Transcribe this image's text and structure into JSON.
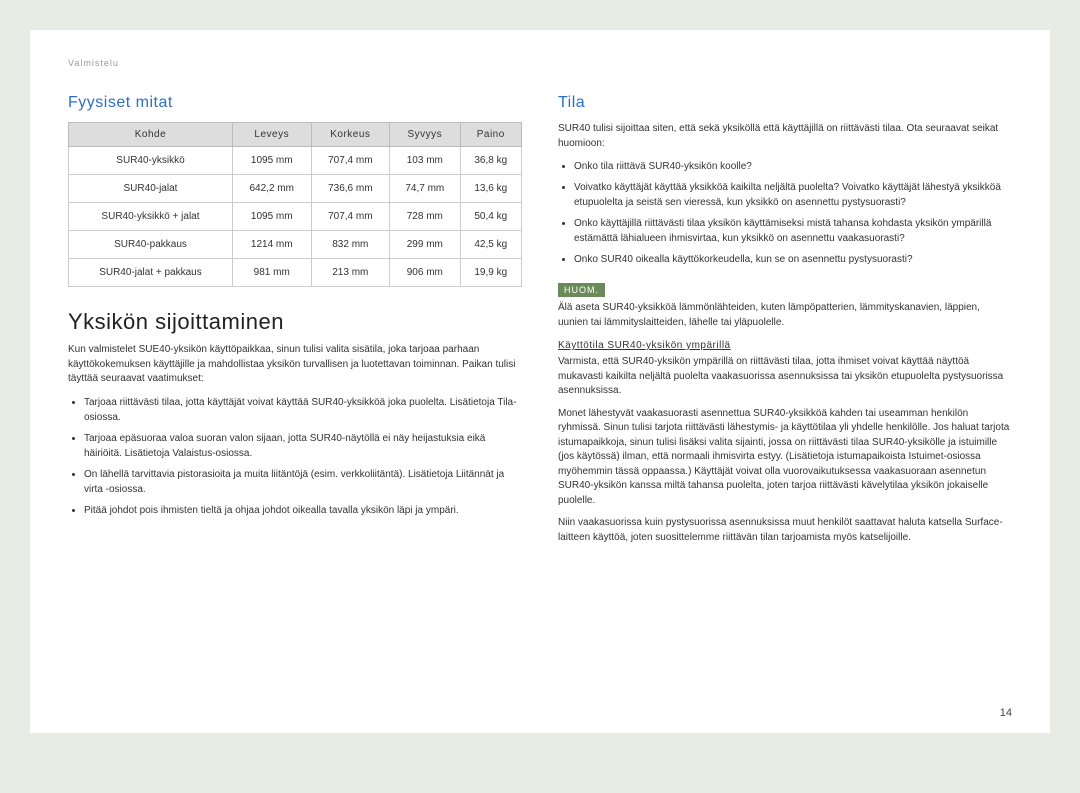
{
  "header": "Valmistelu",
  "left": {
    "h2": "Fyysiset mitat",
    "table": {
      "headers": [
        "Kohde",
        "Leveys",
        "Korkeus",
        "Syvyys",
        "Paino"
      ],
      "rows": [
        [
          "SUR40-yksikkö",
          "1095 mm",
          "707,4 mm",
          "103 mm",
          "36,8 kg"
        ],
        [
          "SUR40-jalat",
          "642,2 mm",
          "736,6 mm",
          "74,7 mm",
          "13,6 kg"
        ],
        [
          "SUR40-yksikkö + jalat",
          "1095 mm",
          "707,4 mm",
          "728 mm",
          "50,4 kg"
        ],
        [
          "SUR40-pakkaus",
          "1214 mm",
          "832 mm",
          "299 mm",
          "42,5 kg"
        ],
        [
          "SUR40-jalat + pakkaus",
          "981 mm",
          "213 mm",
          "906 mm",
          "19,9 kg"
        ]
      ]
    },
    "h1": "Yksikön sijoittaminen",
    "p1": "Kun valmistelet SUE40-yksikön käyttöpaikkaa, sinun tulisi valita sisätila, joka tarjoaa parhaan käyttökokemuksen käyttäjille ja mahdollistaa yksikön turvallisen ja luotettavan toiminnan. Paikan tulisi täyttää seuraavat vaatimukset:",
    "bullets": [
      "Tarjoaa riittävästi tilaa, jotta käyttäjät voivat käyttää SUR40-yksikköä joka puolelta. Lisätietoja Tila-osiossa.",
      "Tarjoaa epäsuoraa valoa suoran valon sijaan, jotta SUR40-näytöllä ei näy heijastuksia eikä häiriöitä. Lisätietoja Valaistus-osiossa.",
      "On lähellä tarvittavia pistorasioita ja muita liitäntöjä (esim. verkkoliitäntä). Lisätietoja Liitännät ja virta -osiossa.",
      "Pitää johdot pois ihmisten tieltä ja ohjaa johdot oikealla tavalla yksikön läpi ja ympäri."
    ]
  },
  "right": {
    "h2": "Tila",
    "p1": "SUR40 tulisi sijoittaa siten, että sekä yksiköllä että käyttäjillä on riittävästi tilaa. Ota seuraavat seikat huomioon:",
    "bullets": [
      "Onko tila riittävä SUR40-yksikön koolle?",
      "Voivatko käyttäjät käyttää yksikköä kaikilta neljältä puolelta? Voivatko käyttäjät lähestyä yksikköä etupuolelta ja seistä sen vieressä, kun yksikkö on asennettu pystysuorasti?",
      "Onko käyttäjillä riittävästi tilaa yksikön käyttämiseksi mistä tahansa kohdasta yksikön ympärillä estämättä lähialueen ihmisvirtaa, kun yksikkö on asennettu vaakasuorasti?",
      "Onko SUR40 oikealla käyttökorkeudella, kun se on asennettu pystysuorasti?"
    ],
    "note_label": "HUOM.",
    "note_text": "Älä aseta SUR40-yksikköä lämmönlähteiden, kuten lämpöpatterien, lämmityskanavien, läppien, uunien tai lämmityslaitteiden, lähelle tai yläpuolelle.",
    "sub_heading": "Käyttötila SUR40-yksikön ympärillä",
    "p2": "Varmista, että SUR40-yksikön ympärillä on riittävästi tilaa, jotta ihmiset voivat käyttää näyttöä mukavasti kaikilta neljältä puolelta vaakasuorissa asennuksissa tai yksikön etupuolelta pystysuorissa asennuksissa.",
    "p3": "Monet lähestyvät vaakasuorasti asennettua SUR40-yksikköä kahden tai useamman henkilön ryhmissä. Sinun tulisi tarjota riittävästi lähestymis- ja käyttötilaa yli yhdelle henkilölle. Jos haluat tarjota istumapaikkoja, sinun tulisi lisäksi valita sijainti, jossa on riittävästi tilaa SUR40-yksikölle ja istuimille (jos käytössä) ilman, että normaali ihmisvirta estyy. (Lisätietoja istumapaikoista Istuimet-osiossa myöhemmin tässä oppaassa.) Käyttäjät voivat olla vuorovaikutuksessa vaakasuoraan asennetun SUR40-yksikön kanssa miltä tahansa puolelta, joten tarjoa riittävästi kävelytilaa yksikön jokaiselle puolelle.",
    "p4": "Niin vaakasuorissa kuin pystysuorissa asennuksissa muut henkilöt saattavat haluta katsella Surface-laitteen käyttöä, joten suosittelemme riittävän tilan tarjoamista myös katselijoille."
  },
  "page_number": "14"
}
